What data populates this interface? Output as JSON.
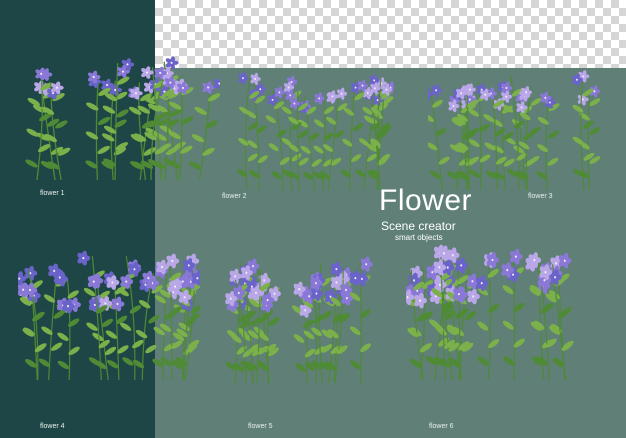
{
  "title": "Flower",
  "subtitle": "Scene creator",
  "tagline": "smart objects",
  "labels": [
    "flower 1",
    "flower 2",
    "flower 3",
    "flower 4",
    "flower 5",
    "flower 6"
  ],
  "colors": {
    "background": "#5f7f77",
    "left_panel": "#1e4646",
    "stem": "#4f8a35",
    "leaf": "#7bb04a",
    "petal_purple": "#8a78d6",
    "petal_lilac": "#b9a7e8",
    "petal_blue": "#6a63c9"
  }
}
